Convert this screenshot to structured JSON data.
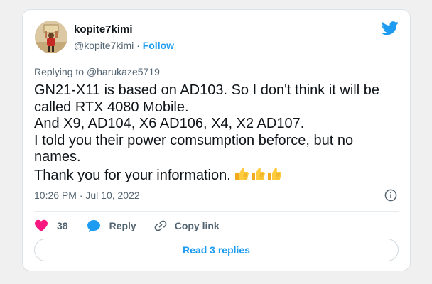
{
  "user": {
    "display_name": "kopite7kimi",
    "handle": "@kopite7kimi",
    "separator": "·",
    "follow_label": "Follow"
  },
  "reply_to": {
    "prefix": "Replying to",
    "handle": "@harukaze5719"
  },
  "tweet": {
    "lines": [
      "GN21-X11 is based on AD103. So I don't think it will be",
      "called RTX 4080 Mobile.",
      "And X9, AD104, X6 AD106, X4, X2 AD107.",
      "I told you their power comsumption beforce, but no",
      "names.",
      "Thank you for your information."
    ],
    "emoji": [
      "thumbs-up",
      "thumbs-up",
      "thumbs-up"
    ]
  },
  "meta": {
    "timestamp": "10:26 PM · Jul 10, 2022"
  },
  "actions": {
    "like_count": "38",
    "reply_label": "Reply",
    "copy_label": "Copy link"
  },
  "footer": {
    "read_replies_label": "Read 3 replies"
  },
  "colors": {
    "accent": "#1d9bf0",
    "like": "#f91880",
    "text": "#0f1419",
    "secondary": "#536471"
  }
}
